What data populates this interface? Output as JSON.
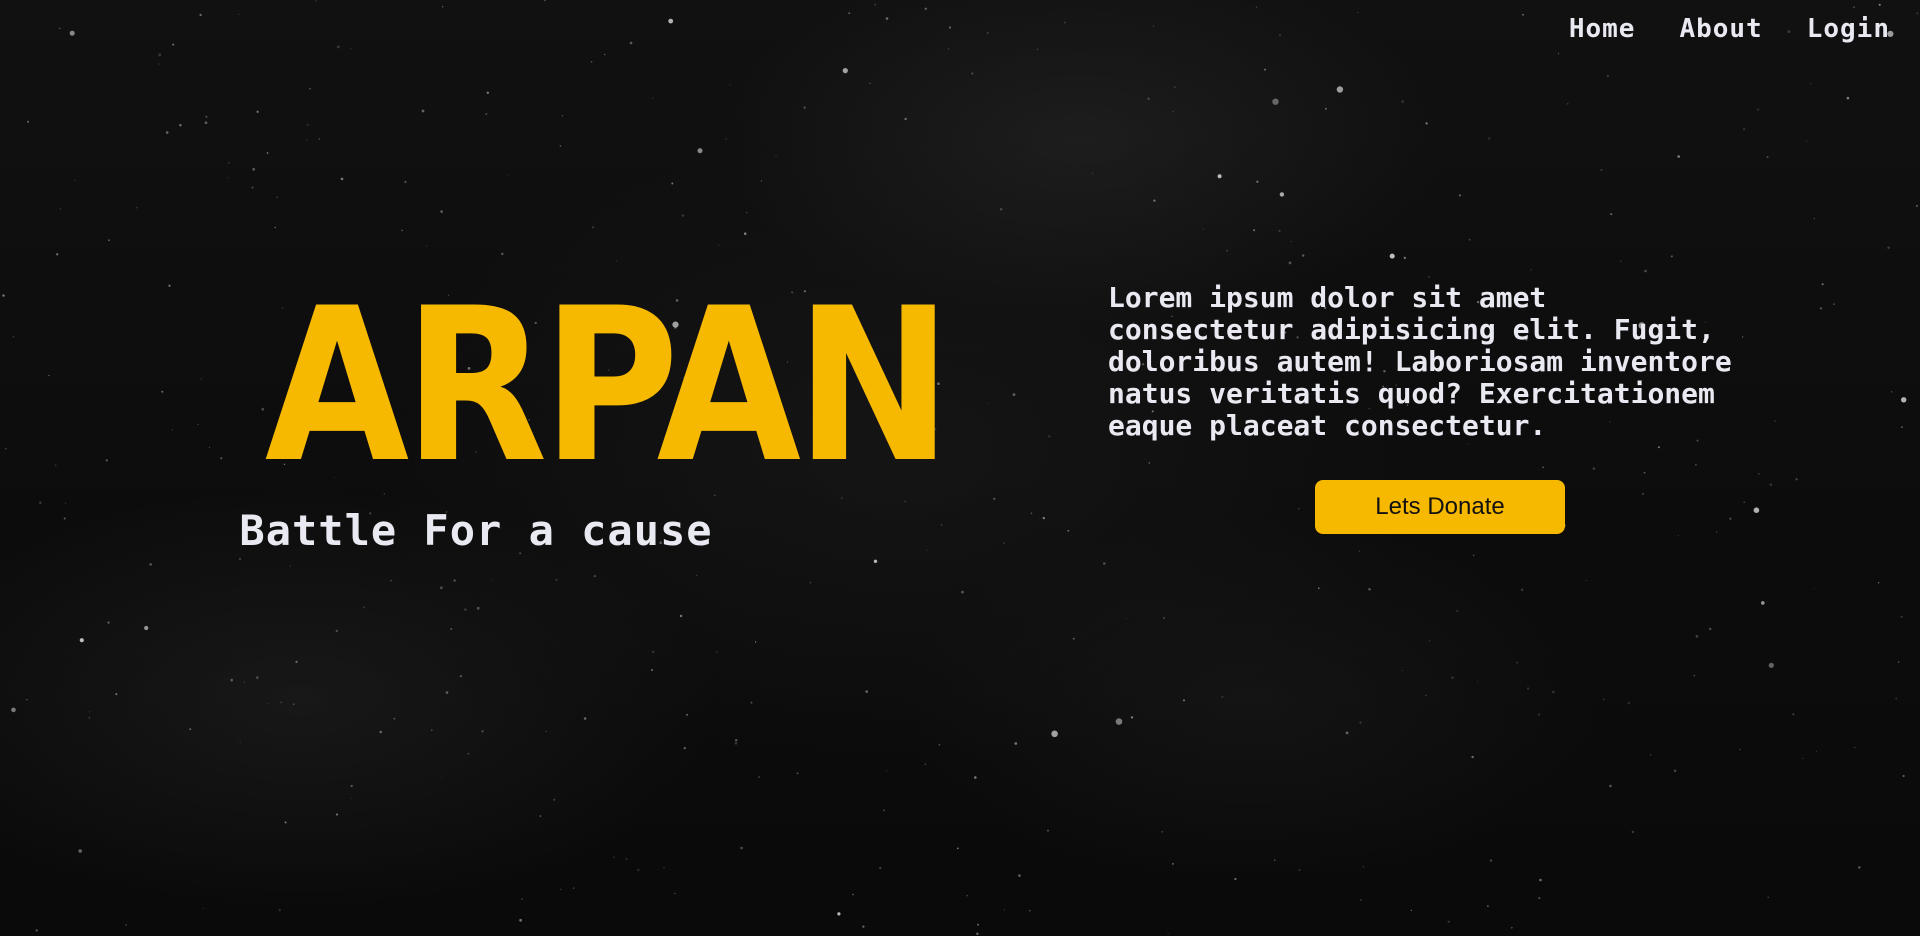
{
  "nav": {
    "items": [
      {
        "label": "Home"
      },
      {
        "label": "About"
      },
      {
        "label": "Login"
      }
    ]
  },
  "hero": {
    "brand": "ARPAN",
    "tagline": "Battle For a cause",
    "description": "Lorem ipsum dolor sit amet consectetur adipisicing elit. Fugit, doloribus autem! Laboriosam inventore natus veritatis quod? Exercitationem eaque placeat consectetur.",
    "cta_label": "Lets Donate"
  },
  "colors": {
    "accent": "#f7b800",
    "text": "#e9e9f2",
    "background": "#0b0b0b"
  }
}
